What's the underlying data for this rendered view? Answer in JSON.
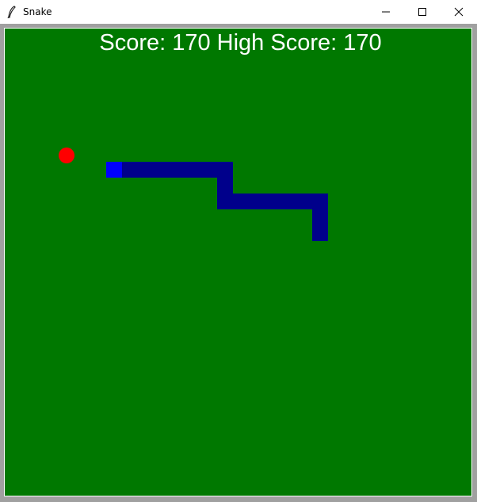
{
  "window": {
    "title": "Snake"
  },
  "titlebar_buttons": {
    "minimize": "minimize-icon",
    "maximize": "maximize-icon",
    "close": "close-icon"
  },
  "hud": {
    "score_text": "Score: 170 High Score: 170"
  },
  "game": {
    "score": 170,
    "high_score": 170,
    "grid": {
      "cols": 30,
      "rows": 30
    },
    "colors": {
      "board": "#007800",
      "snake_body": "#00008b",
      "snake_head": "#0000ff",
      "food": "#ff0000",
      "text": "#ffffff"
    },
    "snake": [
      [
        7,
        9
      ],
      [
        8,
        9
      ],
      [
        9,
        9
      ],
      [
        10,
        9
      ],
      [
        11,
        9
      ],
      [
        12,
        9
      ],
      [
        13,
        9
      ],
      [
        14,
        9
      ],
      [
        14,
        10
      ],
      [
        14,
        11
      ],
      [
        15,
        11
      ],
      [
        16,
        11
      ],
      [
        17,
        11
      ],
      [
        18,
        11
      ],
      [
        19,
        11
      ],
      [
        20,
        11
      ],
      [
        20,
        12
      ],
      [
        20,
        13
      ]
    ],
    "food": [
      4,
      8
    ]
  }
}
